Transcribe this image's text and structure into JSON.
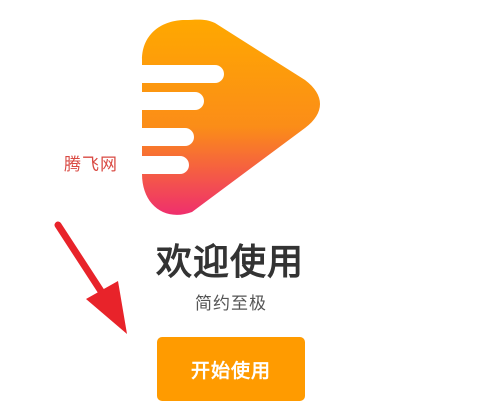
{
  "app": {
    "logo_icon": "play-logo-icon",
    "watermark": "腾飞网",
    "title": "欢迎使用",
    "subtitle": "简约至极",
    "start_button_label": "开始使用"
  },
  "annotation": {
    "arrow_icon": "red-arrow-icon",
    "arrow_color": "#e8232a"
  },
  "colors": {
    "accent": "#ff9b00",
    "logo_top": "#ffa400",
    "logo_bottom": "#f0306e",
    "title_text": "#333333",
    "watermark_text": "#d94a43"
  }
}
